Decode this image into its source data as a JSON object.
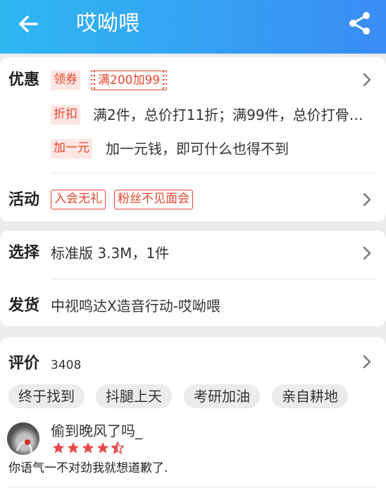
{
  "header": {
    "title": "哎呦喂",
    "bg_from": "#2fb8f0",
    "bg_to": "#3a8cf5",
    "back_icon": "arrow-left-icon",
    "share_icon": "share-icon"
  },
  "promo": {
    "label": "优惠",
    "coupon_tag": "领券",
    "coupon": "满200加99",
    "discount_tag": "折扣",
    "discount_text": "满2件，总价打11折；满99件，总价打骨…",
    "extra_tag": "加一元",
    "extra_text": "加一元钱，即可什么也得不到"
  },
  "activity": {
    "label": "活动",
    "tags": [
      "入会无礼",
      "粉丝不见面会"
    ]
  },
  "select": {
    "label": "选择",
    "value": "标准版 3.3M，1件"
  },
  "shipping": {
    "label": "发货",
    "value": "中视鸣达X造音行动-哎呦喂"
  },
  "reviews": {
    "label": "评价",
    "count": "3408",
    "chips": [
      "终于找到",
      "抖腿上天",
      "考研加油",
      "亲自耕地"
    ],
    "first": {
      "user": "偷到晚风了吗_",
      "rating": 4.5,
      "text": "你语气一不对劲我就想道歉了."
    }
  },
  "colors": {
    "accent": "#e8472e",
    "star": "#e84a4a",
    "tag_bg": "#fde7e4",
    "page_bg": "#ececec"
  }
}
